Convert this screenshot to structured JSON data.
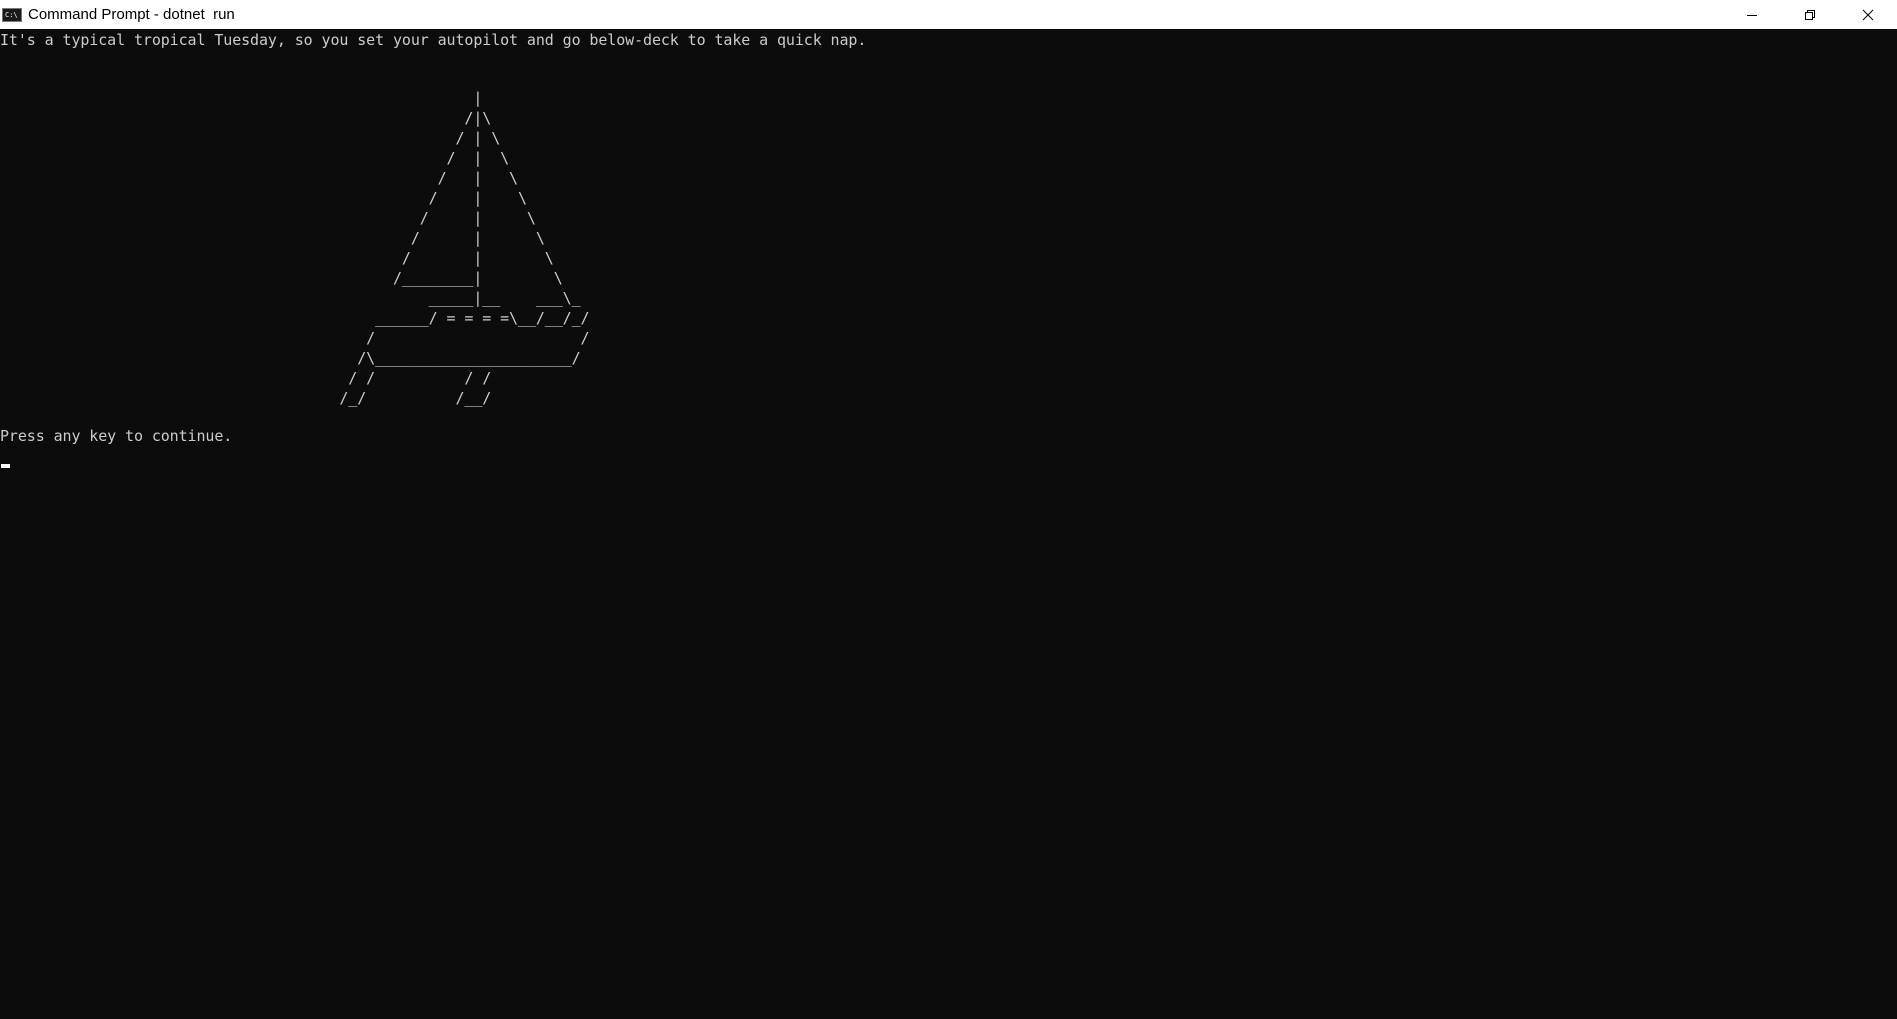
{
  "window": {
    "title": "Command Prompt - dotnet  run",
    "icon": "cmd-icon",
    "icon_text": "C:\\",
    "controls": [
      "minimize-icon",
      "restore-icon",
      "close-icon"
    ]
  },
  "terminal": {
    "intro_line": "It's a typical tropical Tuesday, so you set your autopilot and go below-deck to take a quick nap.",
    "ascii_art": "                                                     |\n                                                    /|\\\n                                                   / | \\\n                                                  /  |  \\\n                                                 /   |   \\\n                                                /    |    \\\n                                               /     |     \\\n                                              /      |      \\\n                                             /       |       \\\n                                            /________|        \\\n                                                _____|__    ___\\_\n                                          ______/ = = = =\\__/__/_/\n                                         /                       /\n                                        /\\______________________/\n                                       / /          / /\n                                      /_/          /__/",
    "prompt_line": "Press any key to continue.",
    "background": "#0c0c0c",
    "foreground": "#cccccc"
  }
}
